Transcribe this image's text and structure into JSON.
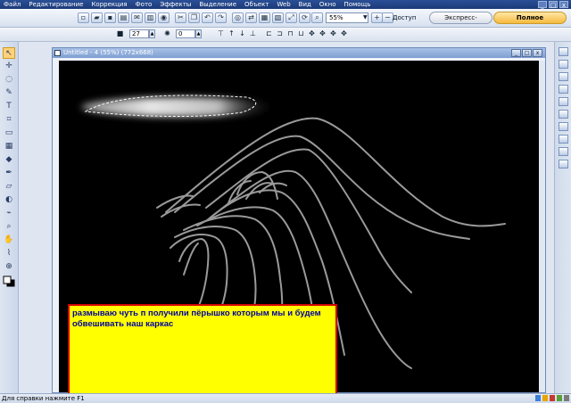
{
  "menu": {
    "items": [
      "Файл",
      "Редактирование",
      "Коррекция",
      "Фото",
      "Эффекты",
      "Выделение",
      "Объект",
      "Web",
      "Вид",
      "Окно",
      "Помощь"
    ],
    "window_controls": [
      "_",
      "□",
      "x"
    ]
  },
  "toolbar": {
    "zoom_value": "55%",
    "access_label": "Доступ",
    "quick_fix_label": "Экспресс-коррекция",
    "full_edit_label": "Полное редактиров..."
  },
  "options": {
    "brush_size": "27",
    "opacity": "0"
  },
  "document": {
    "title": "Untitled - 4 (55%) (772x668)"
  },
  "caption": {
    "text": "размываю чуть п получили пёрышко которым мы и будем обвешивать наш каркас"
  },
  "status": {
    "text": "Для справки нажмите F1"
  },
  "colors": {
    "caption_bg": "#ffff00",
    "caption_border": "#d10000",
    "caption_text": "#0000a0",
    "canvas_bg": "#000000",
    "stroke": "#9a9a9a"
  },
  "icons": {
    "tools": [
      "arrow-icon",
      "move-icon",
      "lasso-icon",
      "brush-icon",
      "text-icon",
      "crop-icon",
      "marquee-icon",
      "grid-icon",
      "shape-icon",
      "pen-icon",
      "eraser-icon",
      "bucket-icon",
      "dropper-icon",
      "zoom-icon",
      "hand-icon",
      "eyedropper-icon",
      "stamp-icon",
      "color-swatch-icon"
    ]
  }
}
